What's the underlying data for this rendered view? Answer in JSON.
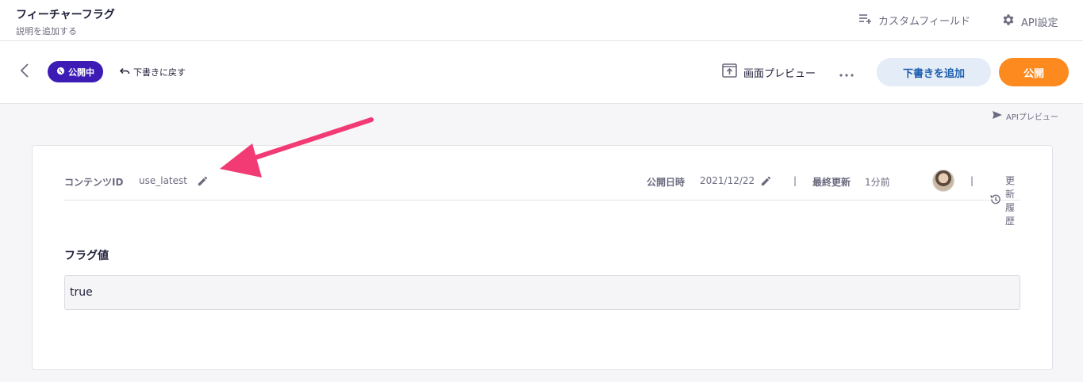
{
  "header": {
    "title": "フィーチャーフラグ",
    "subtitle": "説明を追加する",
    "custom_fields_label": "カスタムフィールド",
    "api_settings_label": "API設定"
  },
  "toolbar": {
    "status_label": "公開中",
    "revert_label": "下書きに戻す",
    "preview_label": "画面プレビュー",
    "draft_button_label": "下書きを追加",
    "publish_button_label": "公開"
  },
  "api_preview_label": "APIプレビュー",
  "meta": {
    "content_id_label": "コンテンツID",
    "content_id_value": "use_latest",
    "published_label": "公開日時",
    "published_value": "2021/12/22",
    "updated_label": "最終更新",
    "updated_value": "1分前",
    "separator": "|",
    "history_label": "更新履歴"
  },
  "field": {
    "label": "フラグ値",
    "value": "true"
  },
  "colors": {
    "status_badge": "#3c1cb5",
    "publish_button": "#fc8a1f",
    "draft_button_bg": "#e4ecf7",
    "draft_button_text": "#1e5fb0",
    "annotation_arrow": "#f23a74"
  }
}
